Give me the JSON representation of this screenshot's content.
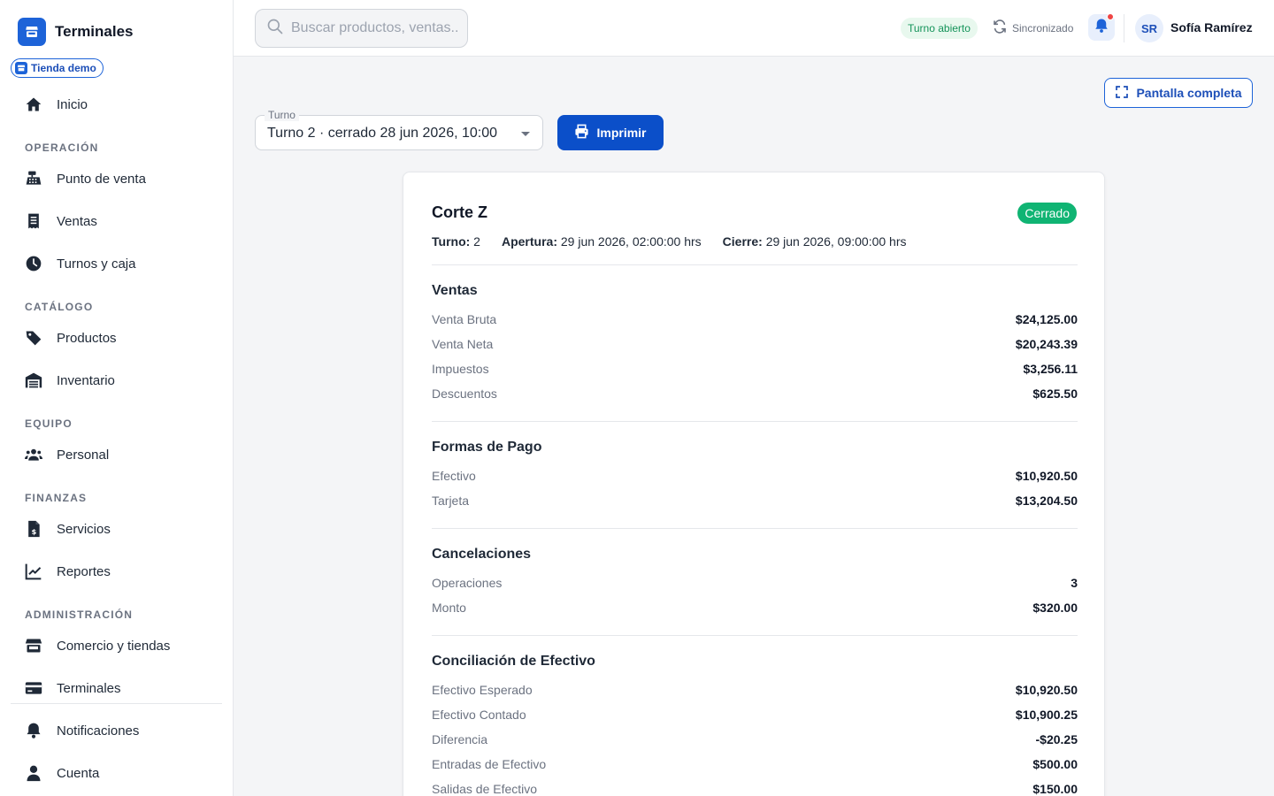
{
  "app": {
    "name": "Terminales",
    "store": "Tienda demo"
  },
  "sidebar": {
    "home": {
      "label": "Inicio",
      "icon": "home-icon"
    },
    "sections": {
      "operacion": "OPERACIÓN",
      "catalogo": "CATÁLOGO",
      "equipo": "EQUIPO",
      "finanzas": "FINANZAS",
      "administracion": "ADMINISTRACIÓN"
    },
    "items": {
      "punto_de_venta": "Punto de venta",
      "ventas": "Ventas",
      "turnos_y_caja": "Turnos y caja",
      "productos": "Productos",
      "inventario": "Inventario",
      "personal": "Personal",
      "servicios": "Servicios",
      "reportes": "Reportes",
      "comercio_y_tiendas": "Comercio y tiendas",
      "terminales": "Terminales",
      "notificaciones": "Notificaciones",
      "cuenta": "Cuenta"
    }
  },
  "topbar": {
    "search_placeholder": "Buscar productos, ventas...",
    "shift_status": "Turno abierto",
    "sync_status": "Sincronizado",
    "user_initials": "SR",
    "user_name": "Sofía Ramírez"
  },
  "toolbar": {
    "fullscreen_label": "Pantalla completa",
    "turno_legend": "Turno",
    "turno_value": "Turno 2 · cerrado 28 jun 2026, 10:00",
    "print_label": "Imprimir"
  },
  "report": {
    "title": "Corte Z",
    "status": "Cerrado",
    "meta": {
      "turno_label": "Turno:",
      "turno_value": "2",
      "apertura_label": "Apertura:",
      "apertura_value": "29 jun 2026, 02:00:00 hrs",
      "cierre_label": "Cierre:",
      "cierre_value": "29 jun 2026, 09:00:00 hrs"
    },
    "sections": [
      {
        "title": "Ventas",
        "rows": [
          {
            "label": "Venta Bruta",
            "value": "$24,125.00"
          },
          {
            "label": "Venta Neta",
            "value": "$20,243.39"
          },
          {
            "label": "Impuestos",
            "value": "$3,256.11"
          },
          {
            "label": "Descuentos",
            "value": "$625.50"
          }
        ]
      },
      {
        "title": "Formas de Pago",
        "rows": [
          {
            "label": "Efectivo",
            "value": "$10,920.50"
          },
          {
            "label": "Tarjeta",
            "value": "$13,204.50"
          }
        ]
      },
      {
        "title": "Cancelaciones",
        "rows": [
          {
            "label": "Operaciones",
            "value": "3"
          },
          {
            "label": "Monto",
            "value": "$320.00"
          }
        ]
      },
      {
        "title": "Conciliación de Efectivo",
        "rows": [
          {
            "label": "Efectivo Esperado",
            "value": "$10,920.50"
          },
          {
            "label": "Efectivo Contado",
            "value": "$10,900.25"
          },
          {
            "label": "Diferencia",
            "value": "-$20.25"
          },
          {
            "label": "Entradas de Efectivo",
            "value": "$500.00"
          },
          {
            "label": "Salidas de Efectivo",
            "value": "$150.00"
          }
        ]
      }
    ]
  },
  "colors": {
    "primary": "#1d63d8",
    "button": "#0b4fc9",
    "success": "#10b473",
    "notification_dot": "#ef4444"
  }
}
